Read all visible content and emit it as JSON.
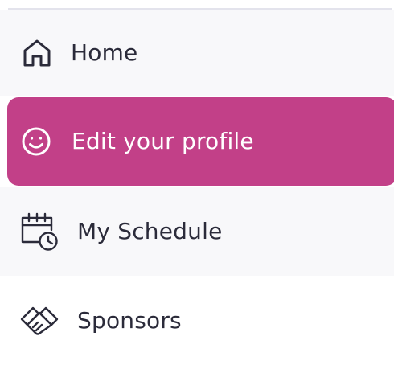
{
  "nav": {
    "items": [
      {
        "label": "Home",
        "icon": "home-icon",
        "active": false
      },
      {
        "label": "Edit your profile",
        "icon": "smiley-icon",
        "active": true
      },
      {
        "label": "My Schedule",
        "icon": "calendar-clock-icon",
        "active": false
      },
      {
        "label": "Sponsors",
        "icon": "handshake-icon",
        "active": false
      }
    ]
  },
  "colors": {
    "active_background": "#c24088",
    "active_text": "#ffffff",
    "text": "#2b2b3a",
    "row_background": "#f8f8fa"
  }
}
